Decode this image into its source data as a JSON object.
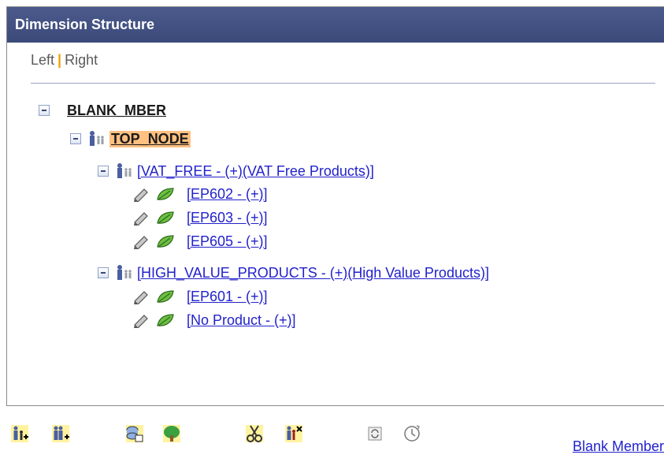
{
  "panel": {
    "title": "Dimension Structure",
    "nav": {
      "left_label": "Left",
      "separator": "|",
      "right_label": "Right"
    }
  },
  "tree": {
    "root": {
      "label": "BLANK_MBER"
    },
    "top_node": {
      "label": "TOP_NODE"
    },
    "groups": [
      {
        "label": "[VAT_FREE - (+)(VAT Free Products)]",
        "leaves": [
          "[EP602 - (+)]",
          "[EP603 - (+)]",
          "[EP605 - (+)]"
        ]
      },
      {
        "label": "[HIGH_VALUE_PRODUCTS - (+)(High Value Products)]",
        "leaves": [
          "[EP601 - (+)]",
          "[No Product - (+)]"
        ]
      }
    ]
  },
  "toolbar": {
    "icons": [
      "insert-child-icon",
      "insert-sibling-icon",
      "insert-detail-icon",
      "tree-icon",
      "cut-icon",
      "delete-node-icon",
      "refresh-icon",
      "effective-date-icon"
    ]
  },
  "footer": {
    "link_label": "Blank Member"
  },
  "colors": {
    "header_bg": "#3c4a7a",
    "link": "#2222cc",
    "highlight": "#ffc080"
  }
}
